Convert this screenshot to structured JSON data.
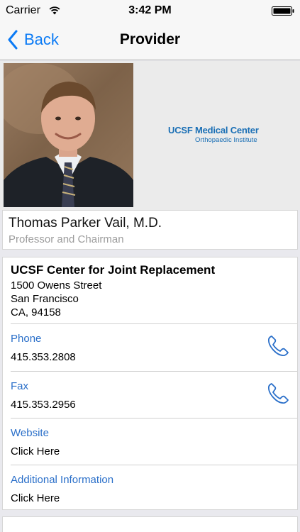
{
  "status_bar": {
    "carrier": "Carrier",
    "time": "3:42 PM"
  },
  "nav": {
    "back_label": "Back",
    "title": "Provider"
  },
  "logo": {
    "main": "UCSF Medical Center",
    "sub": "Orthopaedic Institute"
  },
  "provider": {
    "name": "Thomas Parker Vail, M.D.",
    "title": "Professor and Chairman"
  },
  "location": {
    "name": "UCSF Center for Joint Replacement",
    "address": [
      "1500 Owens Street",
      "San Francisco",
      "CA, 94158"
    ]
  },
  "rows": {
    "phone": {
      "label": "Phone",
      "value": "415.353.2808"
    },
    "fax": {
      "label": "Fax",
      "value": "415.353.2956"
    },
    "website": {
      "label": "Website",
      "value": "Click Here"
    },
    "additional": {
      "label": "Additional Information",
      "value": "Click Here"
    }
  },
  "colors": {
    "accent": "#0a7af5",
    "link_label": "#2a6fc9",
    "logo_blue": "#1a6fb5"
  },
  "icons": {
    "back": "chevron-left-icon",
    "call": "phone-handset-icon",
    "wifi": "wifi-icon",
    "battery": "battery-icon"
  }
}
